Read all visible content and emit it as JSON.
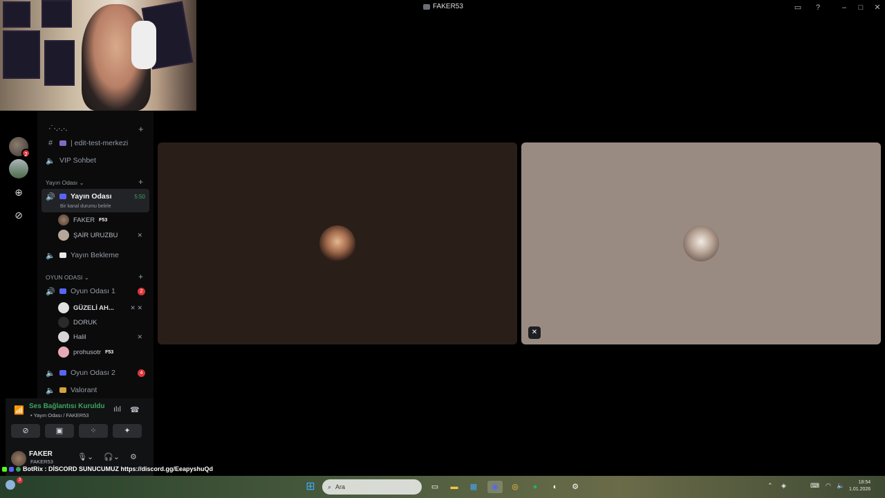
{
  "window": {
    "title": "FAKER53"
  },
  "server": {
    "name": "·˙·.·.·."
  },
  "rail": {
    "badge_count": "2"
  },
  "channels": {
    "text1": "| edit-test-merkezi",
    "voice_vip": "VIP Sohbet",
    "cat_yayin": "Yayın Odası",
    "yayin_odasi": "Yayın Odası",
    "yayin_time": "5:50",
    "yayin_status": "Bir kanal durumu belirle",
    "yayin_bekleme": "Yayın Bekleme",
    "cat_oyun": "OYUN ODASI",
    "oyun1": "Oyun Odası 1",
    "oyun1_count": "2",
    "oyun2": "Oyun Odası 2",
    "oyun2_count": "4",
    "valorant": "Valorant"
  },
  "members": {
    "yayin": [
      {
        "name": "FAKER",
        "tag": "F53"
      },
      {
        "name": "ŞAİR URUZBU",
        "tag": ""
      }
    ],
    "oyun1": [
      {
        "name": "GÜZELİ AH...",
        "tag": ""
      },
      {
        "name": "DORUK",
        "tag": ""
      },
      {
        "name": "Halil",
        "tag": ""
      },
      {
        "name": "prohusotr",
        "tag": "F53"
      }
    ]
  },
  "voice_panel": {
    "title": "Ses Bağlantısı Kuruldu",
    "subtitle": "• Yayın Odası / FAKER53"
  },
  "user": {
    "name": "FAKER",
    "status": "FAKER53"
  },
  "ticker": {
    "text": "BotRix : DİSCORD SUNUCUMUZ https://discord.gg/EeapyshuQd"
  },
  "taskbar": {
    "search_placeholder": "Ara",
    "notif_count": "3",
    "time": "18:54",
    "date": "1.01.2026"
  },
  "colors": {
    "accent_green": "#3ba55d",
    "badge_red": "#da373c",
    "tile_left": "#2a1e19",
    "tile_right": "#9a8b82"
  }
}
